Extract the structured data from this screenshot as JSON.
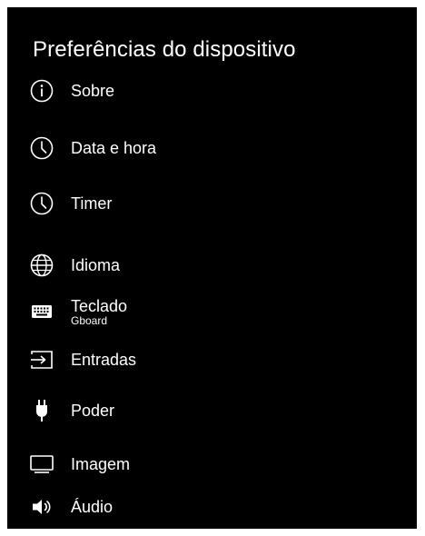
{
  "page": {
    "title": "Preferências do dispositivo"
  },
  "menu": {
    "items": [
      {
        "label": "Sobre",
        "icon": "info-icon"
      },
      {
        "label": "Data e hora",
        "icon": "clock-icon"
      },
      {
        "label": "Timer",
        "icon": "clock-icon"
      },
      {
        "label": "Idioma",
        "icon": "globe-icon"
      },
      {
        "label": "Teclado",
        "sublabel": "Gboard",
        "icon": "keyboard-icon"
      },
      {
        "label": "Entradas",
        "icon": "input-icon"
      },
      {
        "label": "Poder",
        "icon": "power-plug-icon"
      },
      {
        "label": "Imagem",
        "icon": "monitor-icon"
      },
      {
        "label": "Áudio",
        "icon": "speaker-icon"
      }
    ]
  },
  "colors": {
    "background": "#000000",
    "text": "#ffffff",
    "page": "#ffffff"
  }
}
